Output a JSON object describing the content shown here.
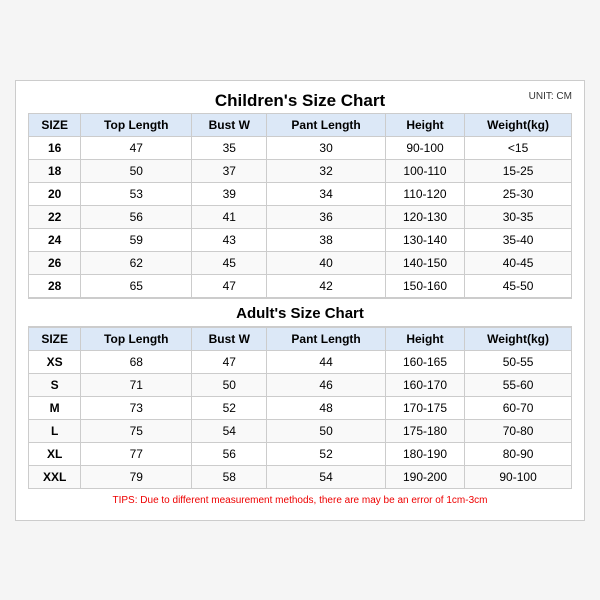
{
  "chart": {
    "main_title": "Children's Size Chart",
    "unit": "UNIT: CM",
    "children_section_title": "Children's Size Chart",
    "adult_section_title": "Adult's Size Chart",
    "tips": "TIPS: Due to different measurement methods, there are may be an error of 1cm-3cm",
    "headers": [
      "SIZE",
      "Top Length",
      "Bust W",
      "Pant Length",
      "Height",
      "Weight(kg)"
    ],
    "children_rows": [
      [
        "16",
        "47",
        "35",
        "30",
        "90-100",
        "<15"
      ],
      [
        "18",
        "50",
        "37",
        "32",
        "100-110",
        "15-25"
      ],
      [
        "20",
        "53",
        "39",
        "34",
        "110-120",
        "25-30"
      ],
      [
        "22",
        "56",
        "41",
        "36",
        "120-130",
        "30-35"
      ],
      [
        "24",
        "59",
        "43",
        "38",
        "130-140",
        "35-40"
      ],
      [
        "26",
        "62",
        "45",
        "40",
        "140-150",
        "40-45"
      ],
      [
        "28",
        "65",
        "47",
        "42",
        "150-160",
        "45-50"
      ]
    ],
    "adult_rows": [
      [
        "XS",
        "68",
        "47",
        "44",
        "160-165",
        "50-55"
      ],
      [
        "S",
        "71",
        "50",
        "46",
        "160-170",
        "55-60"
      ],
      [
        "M",
        "73",
        "52",
        "48",
        "170-175",
        "60-70"
      ],
      [
        "L",
        "75",
        "54",
        "50",
        "175-180",
        "70-80"
      ],
      [
        "XL",
        "77",
        "56",
        "52",
        "180-190",
        "80-90"
      ],
      [
        "XXL",
        "79",
        "58",
        "54",
        "190-200",
        "90-100"
      ]
    ]
  }
}
